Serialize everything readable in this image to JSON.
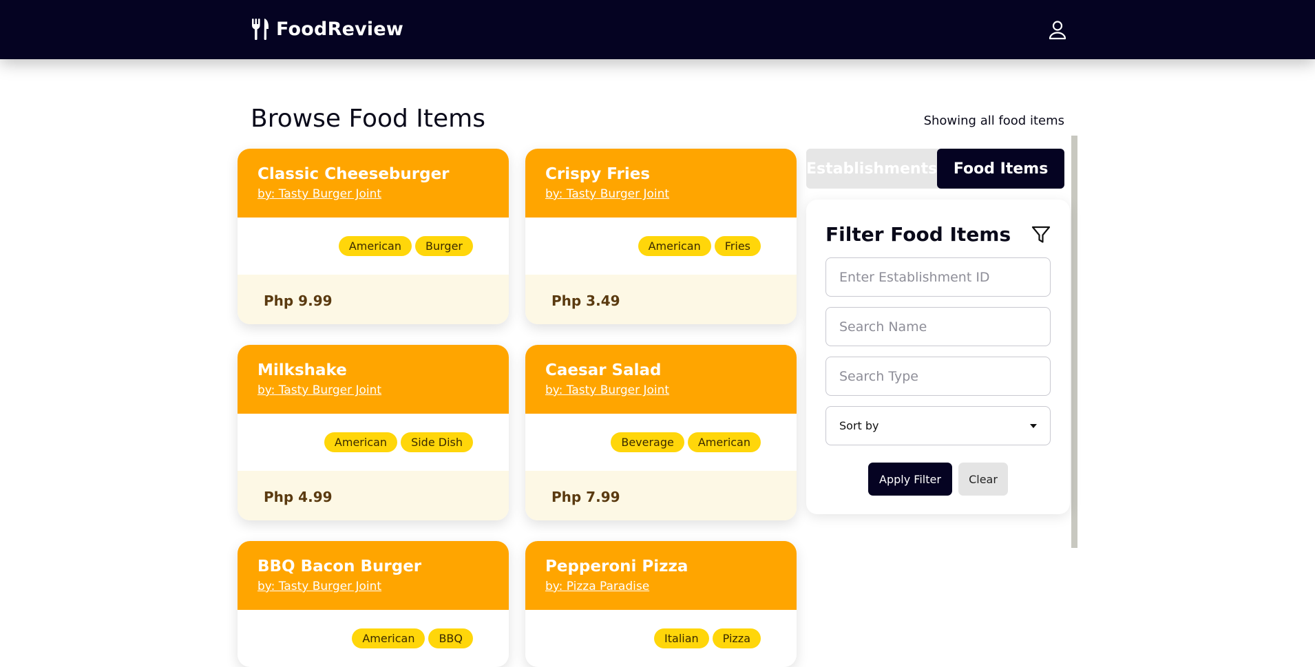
{
  "navbar": {
    "brand": "FoodReview",
    "brand_icon": "fork-knife-icon",
    "user_icon": "user-icon"
  },
  "main": {
    "title": "Browse Food Items",
    "status": "Showing all food items",
    "items": [
      {
        "name": "Classic Cheeseburger",
        "by": "by: Tasty Burger Joint",
        "tags": [
          "American",
          "Burger"
        ],
        "price": "Php 9.99"
      },
      {
        "name": "Crispy Fries",
        "by": "by: Tasty Burger Joint",
        "tags": [
          "American",
          "Fries"
        ],
        "price": "Php 3.49"
      },
      {
        "name": "Milkshake",
        "by": "by: Tasty Burger Joint",
        "tags": [
          "American",
          "Side Dish"
        ],
        "price": "Php 4.99"
      },
      {
        "name": "Caesar Salad",
        "by": "by: Tasty Burger Joint",
        "tags": [
          "Beverage",
          "American"
        ],
        "price": "Php 7.99"
      },
      {
        "name": "BBQ Bacon Burger",
        "by": "by: Tasty Burger Joint",
        "tags": [
          "American",
          "BBQ"
        ],
        "price": ""
      },
      {
        "name": "Pepperoni Pizza",
        "by": "by: Pizza Paradise",
        "tags": [
          "Italian",
          "Pizza"
        ],
        "price": ""
      }
    ]
  },
  "sidebar": {
    "tabs": [
      {
        "label": "Establishments",
        "active": false
      },
      {
        "label": "Food Items",
        "active": true
      }
    ],
    "filter": {
      "title": "Filter Food Items",
      "establishment_placeholder": "Enter Establishment ID",
      "name_placeholder": "Search Name",
      "type_placeholder": "Search Type",
      "sort_label": "Sort by",
      "apply_label": "Apply Filter",
      "clear_label": "Clear"
    }
  },
  "colors": {
    "navbar": "#050322",
    "card_header": "#ffa500",
    "tag": "#ffd60a",
    "price_bg": "#fdf8e5"
  }
}
